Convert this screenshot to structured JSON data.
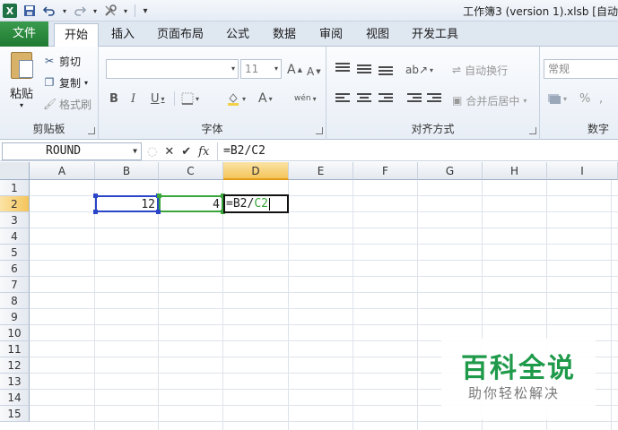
{
  "window": {
    "title": "工作簿3 (version 1).xlsb [自动"
  },
  "qat": {
    "icons": [
      "excel-logo",
      "save-icon",
      "undo-icon",
      "redo-icon",
      "tools-icon",
      "customize-icon"
    ],
    "logo_text": "X"
  },
  "tabs": [
    {
      "label": "文件"
    },
    {
      "label": "开始"
    },
    {
      "label": "插入"
    },
    {
      "label": "页面布局"
    },
    {
      "label": "公式"
    },
    {
      "label": "数据"
    },
    {
      "label": "审阅"
    },
    {
      "label": "视图"
    },
    {
      "label": "开发工具"
    }
  ],
  "ribbon": {
    "clipboard": {
      "paste": "粘贴",
      "cut": "剪切",
      "copy": "复制",
      "format_painter": "格式刷",
      "label": "剪贴板"
    },
    "font": {
      "name_value": "",
      "size_value": "11",
      "grow": "A",
      "shrink": "A",
      "bold": "B",
      "italic": "I",
      "underline": "U",
      "font_color": "A",
      "phonetic": "wén",
      "label": "字体"
    },
    "alignment": {
      "wrap_text": "自动换行",
      "merge_center": "合并后居中",
      "label": "对齐方式"
    },
    "number": {
      "format_value": "常规",
      "percent": "%",
      "label": "数字"
    }
  },
  "formula_bar": {
    "name_box": "ROUND",
    "cancel": "✕",
    "enter": "✔",
    "fx": "fx",
    "formula": "=B2/C2"
  },
  "grid": {
    "columns": [
      "A",
      "B",
      "C",
      "D",
      "E",
      "F",
      "G",
      "H",
      "I"
    ],
    "rows": [
      "1",
      "2",
      "3",
      "4",
      "5",
      "6",
      "7",
      "8",
      "9",
      "10",
      "11",
      "12",
      "13",
      "14",
      "15"
    ],
    "selected_column": "D",
    "selected_row": "2",
    "cells": {
      "B2": "12",
      "C2": "4",
      "D2_prefix": "=B2/",
      "D2_ref": "C2"
    }
  },
  "watermark": {
    "title": "百科全说",
    "subtitle": "助你轻松解决"
  },
  "colors": {
    "file_tab": "#1f7a32",
    "ref_b2": "#2a45c7",
    "ref_c2": "#3aa53a",
    "watermark": "#1f9a4a"
  }
}
